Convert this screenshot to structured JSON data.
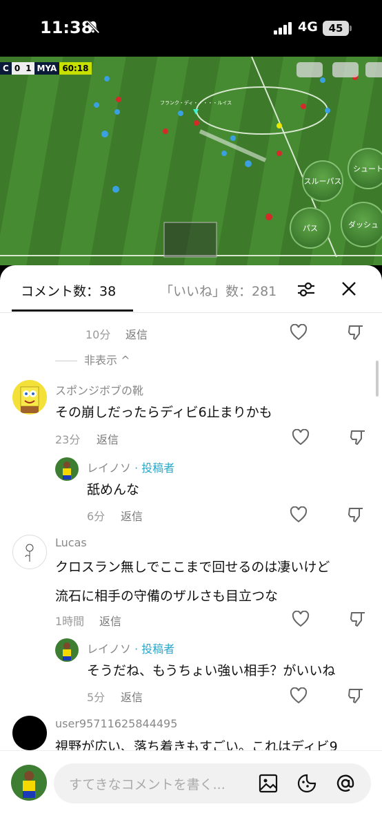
{
  "status": {
    "time": "11:38",
    "network": "4G",
    "battery": "45"
  },
  "video": {
    "score": {
      "home_team": "C",
      "home_score": "0",
      "away_score": "1",
      "away_team": "MYA",
      "clock": "60:18"
    },
    "player_label": "フランク・ディ・・・・・ルイス",
    "buttons": {
      "through_pass": "スルーパス",
      "shoot": "シュート",
      "pass": "パス",
      "dash": "ダッシュ"
    }
  },
  "tabs": {
    "comments": "コメント数：38",
    "likes": "「いいね」数：281"
  },
  "thread": {
    "top_meta": {
      "time": "10分",
      "reply": "返信"
    },
    "hide_label": "非表示 ^",
    "comments": [
      {
        "username": "スポンジボブの靴",
        "text": "その崩しだったらディビ6止まりかも",
        "time": "23分",
        "reply": "返信"
      },
      {
        "username": "レイノソ",
        "author_tag": "· 投稿者",
        "text": "舐めんな",
        "time": "6分",
        "reply": "返信"
      },
      {
        "username": "Lucas",
        "text_line1": "クロスラン無しでここまで回せるのは凄いけど",
        "text_line2": "流石に相手の守備のザルさも目立つな",
        "time": "1時間",
        "reply": "返信"
      },
      {
        "username": "レイノソ",
        "author_tag": "· 投稿者",
        "text": "そうだね、もうちょい強い相手？がいいね",
        "time": "5分",
        "reply": "返信"
      },
      {
        "username": "user95711625844495",
        "text": "視野が広い、落ち着きもすごい。これはディビ9"
      }
    ]
  },
  "input": {
    "placeholder": "すてきなコメントを書く..."
  }
}
